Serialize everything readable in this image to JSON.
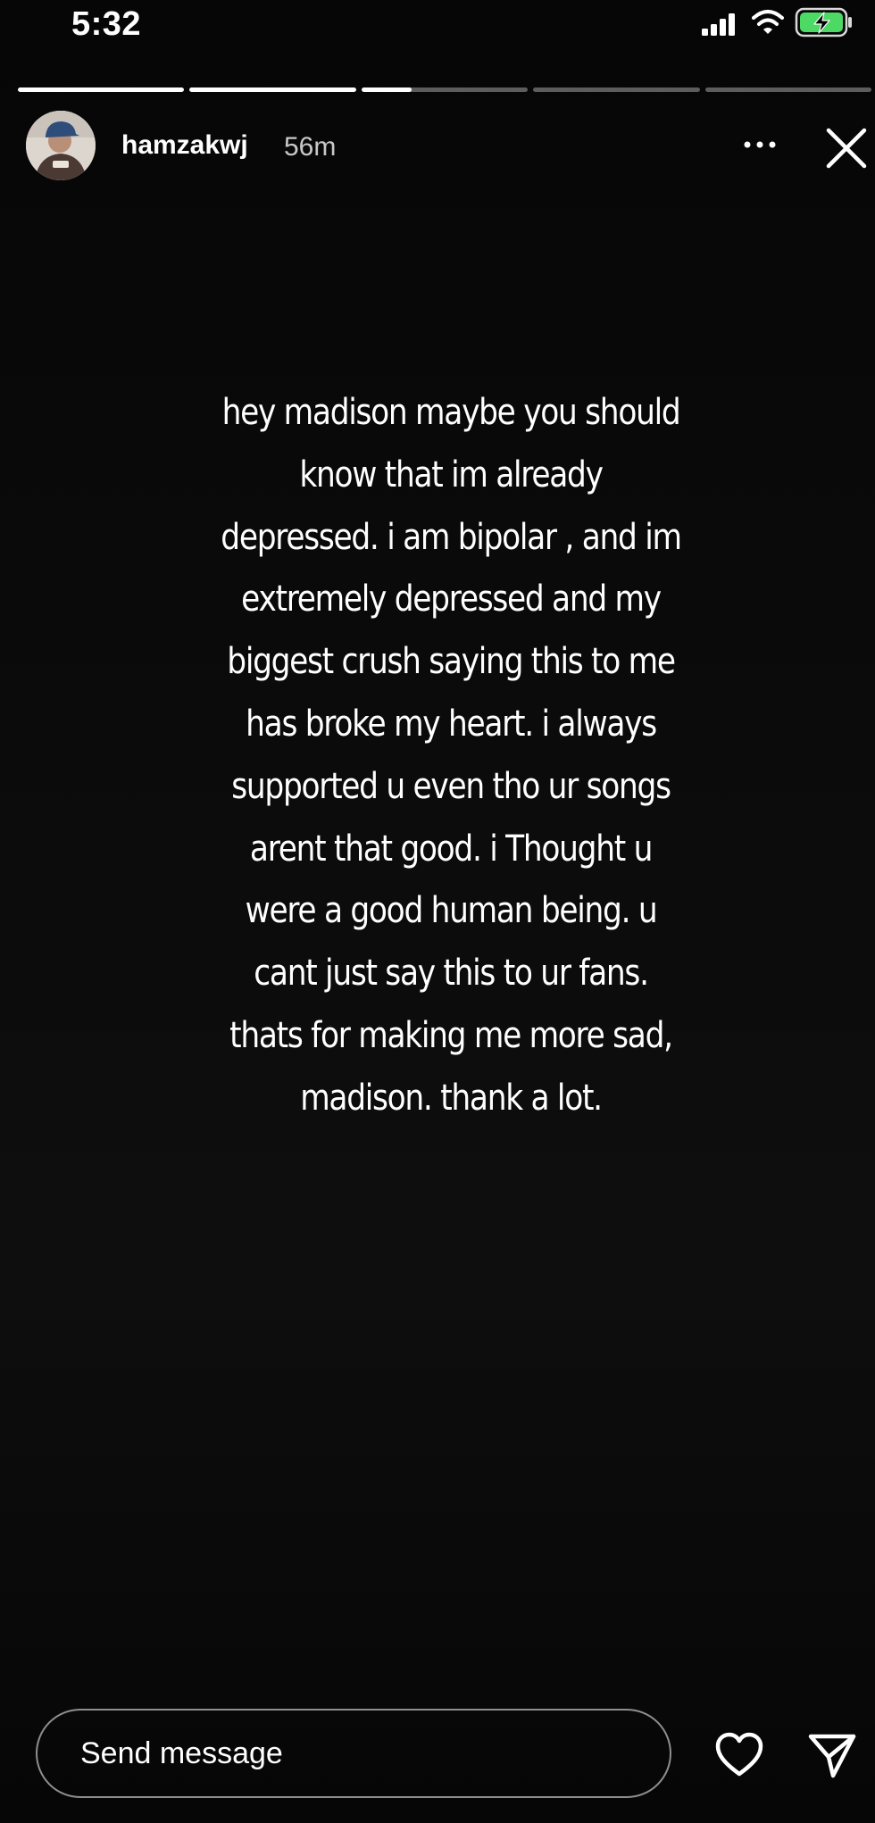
{
  "status_bar": {
    "time": "5:32"
  },
  "icons": {
    "signal": "signal-icon",
    "wifi": "wifi-icon",
    "battery": "battery-charging-icon",
    "more": "more-icon",
    "close": "close-icon",
    "heart": "heart-icon",
    "send": "send-icon"
  },
  "story_progress": [
    1,
    1,
    0.3,
    0,
    0
  ],
  "header": {
    "username": "hamzakwj",
    "time_ago": "56m"
  },
  "story": {
    "text": "hey madison maybe you should\nknow that im already\ndepressed. i am bipolar , and im\nextremely depressed and my\nbiggest crush saying this to me\nhas broke my heart. i always\nsupported u even tho ur songs\narent that good.  i Thought u\nwere a good human being. u\ncant just say this to ur fans.\nthats for making me more sad,\nmadison. thank a lot."
  },
  "reply": {
    "placeholder": "Send message"
  },
  "colors": {
    "background": "#000000",
    "text": "#ffffff",
    "battery": "#4cd964"
  }
}
